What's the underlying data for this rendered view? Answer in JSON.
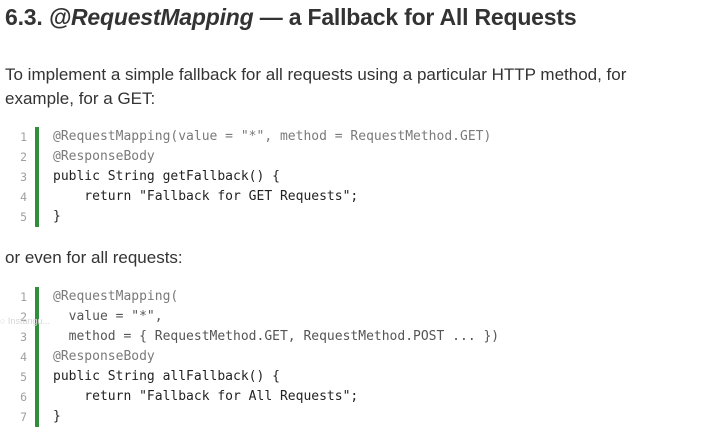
{
  "heading": {
    "number": "6.3.",
    "annotation": "@RequestMapping",
    "rest": "— a Fallback for All Requests"
  },
  "paragraphs": {
    "intro": "To implement a simple fallback for all requests using a particular HTTP method, for example, for a GET:",
    "or_even": "or even for all requests:"
  },
  "code_block_1": {
    "line_numbers": [
      "1",
      "2",
      "3",
      "4",
      "5"
    ],
    "lines": [
      "@RequestMapping(value = \"*\", method = RequestMethod.GET)",
      "@ResponseBody",
      "public String getFallback() {",
      "    return \"Fallback for GET Requests\";",
      "}"
    ]
  },
  "code_block_2": {
    "line_numbers": [
      "1",
      "2",
      "3",
      "4",
      "5",
      "6",
      "7"
    ],
    "lines": [
      "@RequestMapping(",
      "  value = \"*\",",
      "  method = { RequestMethod.GET, RequestMethod.POST ... })",
      "@ResponseBody",
      "public String allFallback() {",
      "    return \"Fallback for All Requests\";",
      "}"
    ]
  },
  "watermark": {
    "text": "○  Instangu..."
  },
  "colors": {
    "accent_bar": "#2f8f3a",
    "text": "#333333",
    "line_number": "#a0a0a0"
  }
}
